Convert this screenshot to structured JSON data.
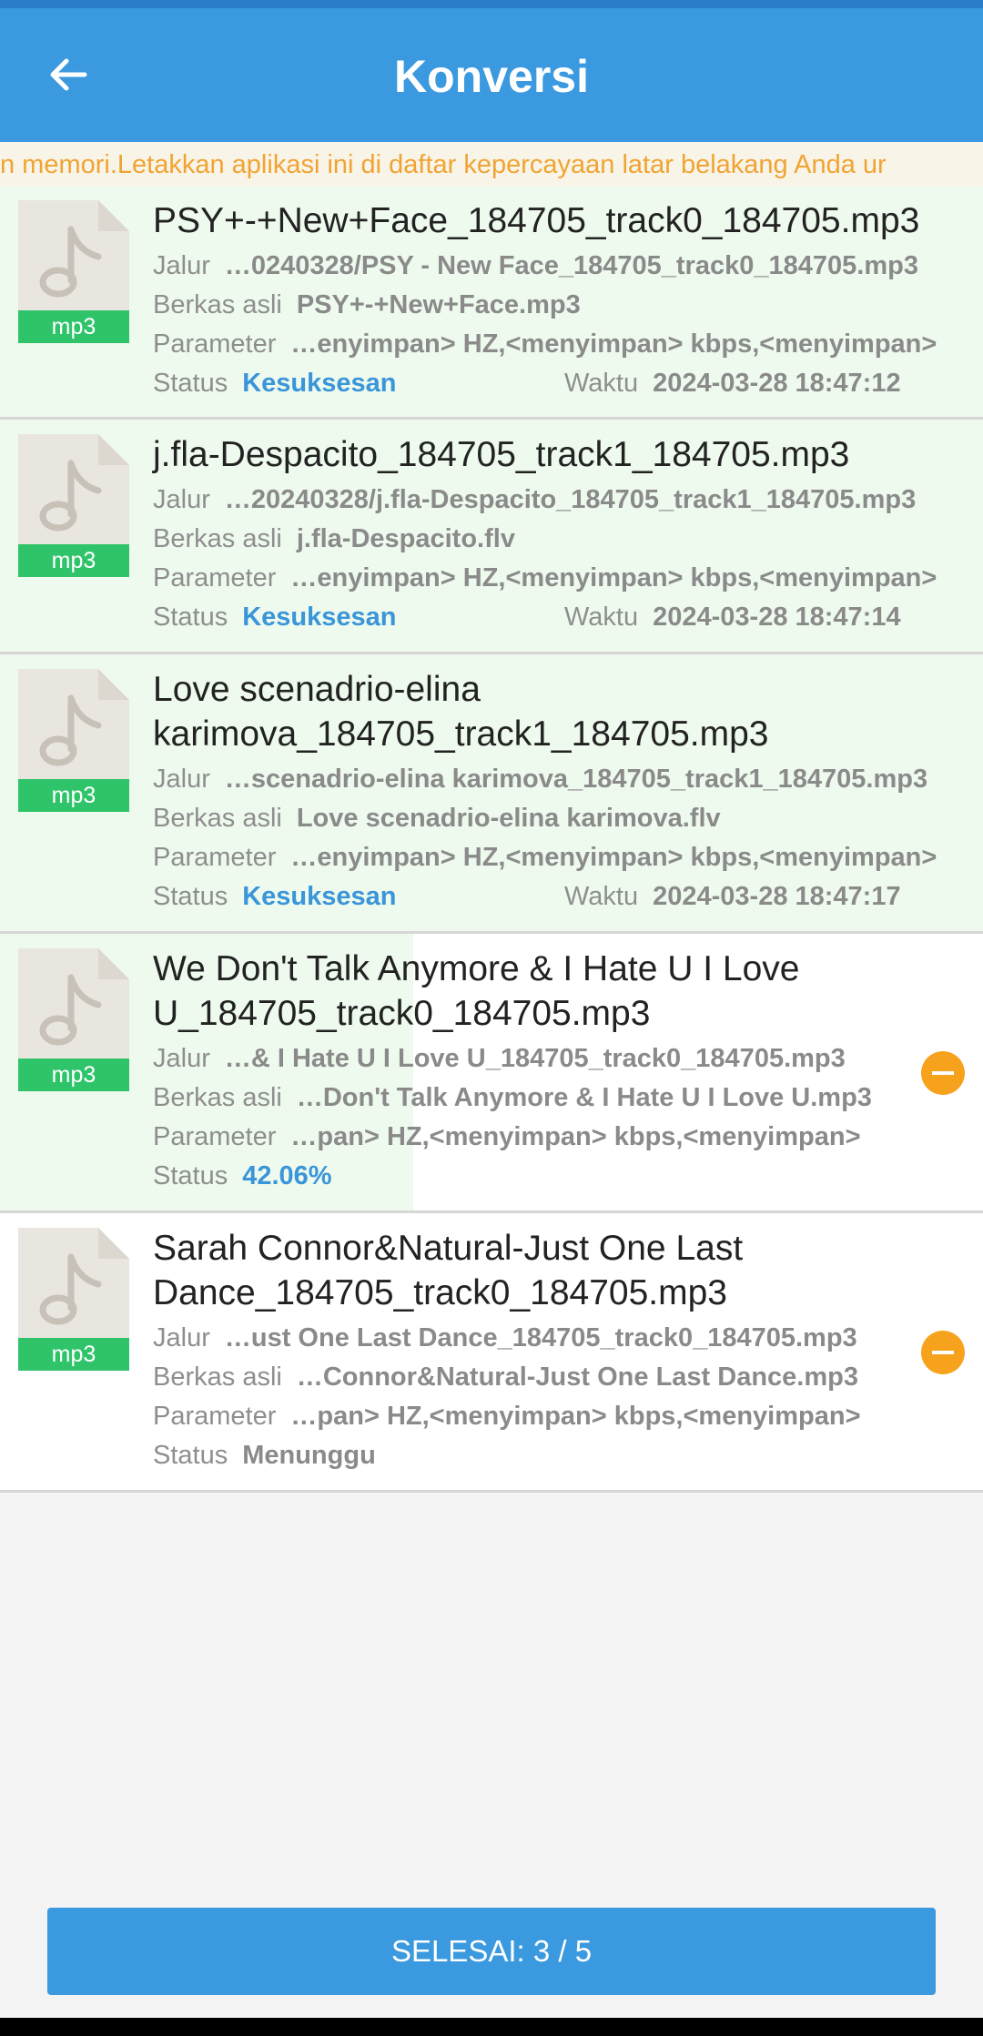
{
  "header": {
    "title": "Konversi"
  },
  "marquee": {
    "text": "n memori.Letakkan aplikasi ini di daftar kepercayaan latar belakang Anda ur"
  },
  "labels": {
    "path": "Jalur",
    "original": "Berkas asli",
    "param": "Parameter",
    "status": "Status",
    "time": "Waktu"
  },
  "colors": {
    "app_bar": "#3a99df",
    "success_fill": "#eefaee",
    "ext_badge": "#2fc46a",
    "warning": "#f0a433",
    "remove": "#f7a21c"
  },
  "items": [
    {
      "ext": "mp3",
      "name": "PSY+-+New+Face_184705_track0_184705.mp3",
      "path": "…0240328/PSY - New Face_184705_track0_184705.mp3",
      "original": "PSY+-+New+Face.mp3",
      "param": "…enyimpan> HZ,<menyimpan> kbps,<menyimpan>",
      "status": "Kesuksesan",
      "time": "2024-03-28 18:47:12",
      "progress": 1.0
    },
    {
      "ext": "mp3",
      "name": "j.fla-Despacito_184705_track1_184705.mp3",
      "path": "…20240328/j.fla-Despacito_184705_track1_184705.mp3",
      "original": "j.fla-Despacito.flv",
      "param": "…enyimpan> HZ,<menyimpan> kbps,<menyimpan>",
      "status": "Kesuksesan",
      "time": "2024-03-28 18:47:14",
      "progress": 1.0
    },
    {
      "ext": "mp3",
      "name": "Love scenadrio-elina karimova_184705_track1_184705.mp3",
      "path": "…scenadrio-elina karimova_184705_track1_184705.mp3",
      "original": "Love scenadrio-elina karimova.flv",
      "param": "…enyimpan> HZ,<menyimpan> kbps,<menyimpan>",
      "status": "Kesuksesan",
      "time": "2024-03-28 18:47:17",
      "progress": 1.0
    },
    {
      "ext": "mp3",
      "name": "We Don't Talk Anymore & I Hate U I Love U_184705_track0_184705.mp3",
      "path": "…& I Hate U I Love U_184705_track0_184705.mp3",
      "original": "…Don't Talk Anymore & I Hate U I Love U.mp3",
      "param": "…pan> HZ,<menyimpan> kbps,<menyimpan>",
      "status": "42.06%",
      "progress": 0.4206
    },
    {
      "ext": "mp3",
      "name": "Sarah Connor&Natural-Just One Last Dance_184705_track0_184705.mp3",
      "path": "…ust One Last Dance_184705_track0_184705.mp3",
      "original": "…Connor&Natural-Just One Last Dance.mp3",
      "param": "…pan> HZ,<menyimpan> kbps,<menyimpan>",
      "status": "Menunggu",
      "progress": 0
    }
  ],
  "footer": {
    "done_label": "SELESAI: 3 / 5"
  }
}
